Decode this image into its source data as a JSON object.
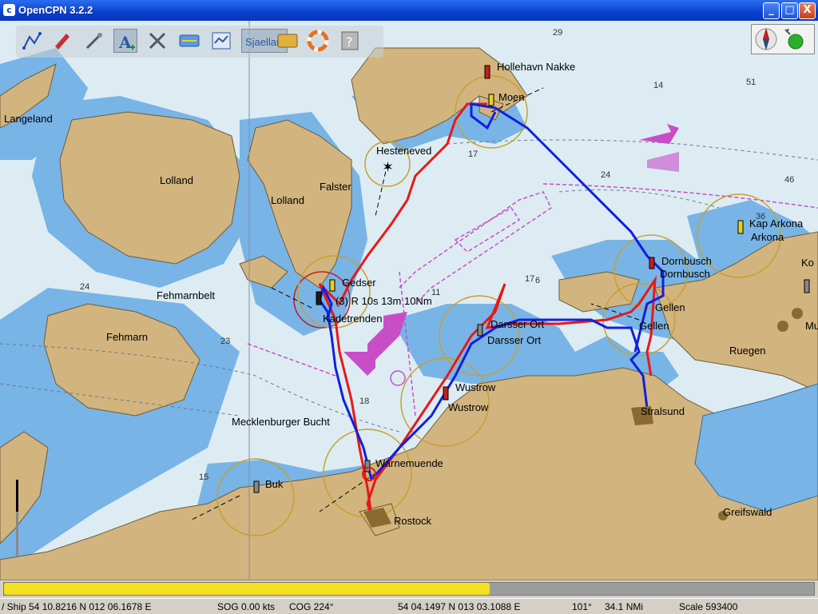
{
  "window": {
    "title": "OpenCPN 3.2.2",
    "icon": "opencpn-logo-icon"
  },
  "window_controls": {
    "minimize": "_",
    "maximize": "□",
    "close": "X"
  },
  "toolbar": {
    "buttons": [
      {
        "name": "route-icon",
        "tooltip": ""
      },
      {
        "name": "ship-icon",
        "tooltip": ""
      },
      {
        "name": "measure-icon",
        "tooltip": ""
      },
      {
        "name": "text-icon",
        "tooltip": ""
      },
      {
        "name": "close-tool-icon",
        "tooltip": ""
      },
      {
        "name": "zoom-icon",
        "tooltip": ""
      },
      {
        "name": "route-manager-icon",
        "tooltip": ""
      },
      {
        "name": "chart-name-icon",
        "tooltip": ""
      },
      {
        "name": "tides-icon",
        "tooltip": ""
      },
      {
        "name": "lifebuoy-icon",
        "tooltip": ""
      },
      {
        "name": "help-icon",
        "tooltip": ""
      }
    ],
    "chart_name": "Sjaelland"
  },
  "chart_labels": {
    "places": [
      "Hollehavn Nakke",
      "Moen",
      "Langeland",
      "Hesteneved",
      "Lolland",
      "Lolland",
      "Falster",
      "Gedser",
      "Kadetrenden",
      "Fehmarnbelt",
      "Fehmarn",
      "Darsser Ort",
      "Darsser Ort",
      "Wustrow",
      "Wustrow",
      "Mecklenburger Bucht",
      "Warnemuende",
      "Rostock",
      "Buk",
      "Kap Arkona",
      "Arkona",
      "Dornbusch",
      "Dornbusch",
      "Gellen",
      "Gellen",
      "Ruegen",
      "Stralsund",
      "Greifswald",
      "Ko",
      "Mu"
    ],
    "light_info": "(3) R 10s 13m 10Nm",
    "depths": [
      "29",
      "51",
      "14",
      "17",
      "24",
      "46",
      "36",
      "17",
      "6",
      "11",
      "24",
      "23",
      "18",
      "15"
    ]
  },
  "colors": {
    "water_deep": "#dcecf2",
    "water_shallow": "#78b4e6",
    "land": "#d2b47e",
    "track_red": "#e81818",
    "track_blue": "#1020e0",
    "nav_magenta": "#c84ec8"
  },
  "progress": {
    "value": 0.6
  },
  "status": {
    "ship": "/ Ship 54 10.8216 N   012 06.1678 E",
    "sog": "SOG 0.00 kts",
    "cog": "COG 224°",
    "cursor": "54 04.1497 N   013 03.1088 E",
    "bearing": "101°",
    "distance": "34.1 NMi",
    "scale": "Scale 593400"
  }
}
